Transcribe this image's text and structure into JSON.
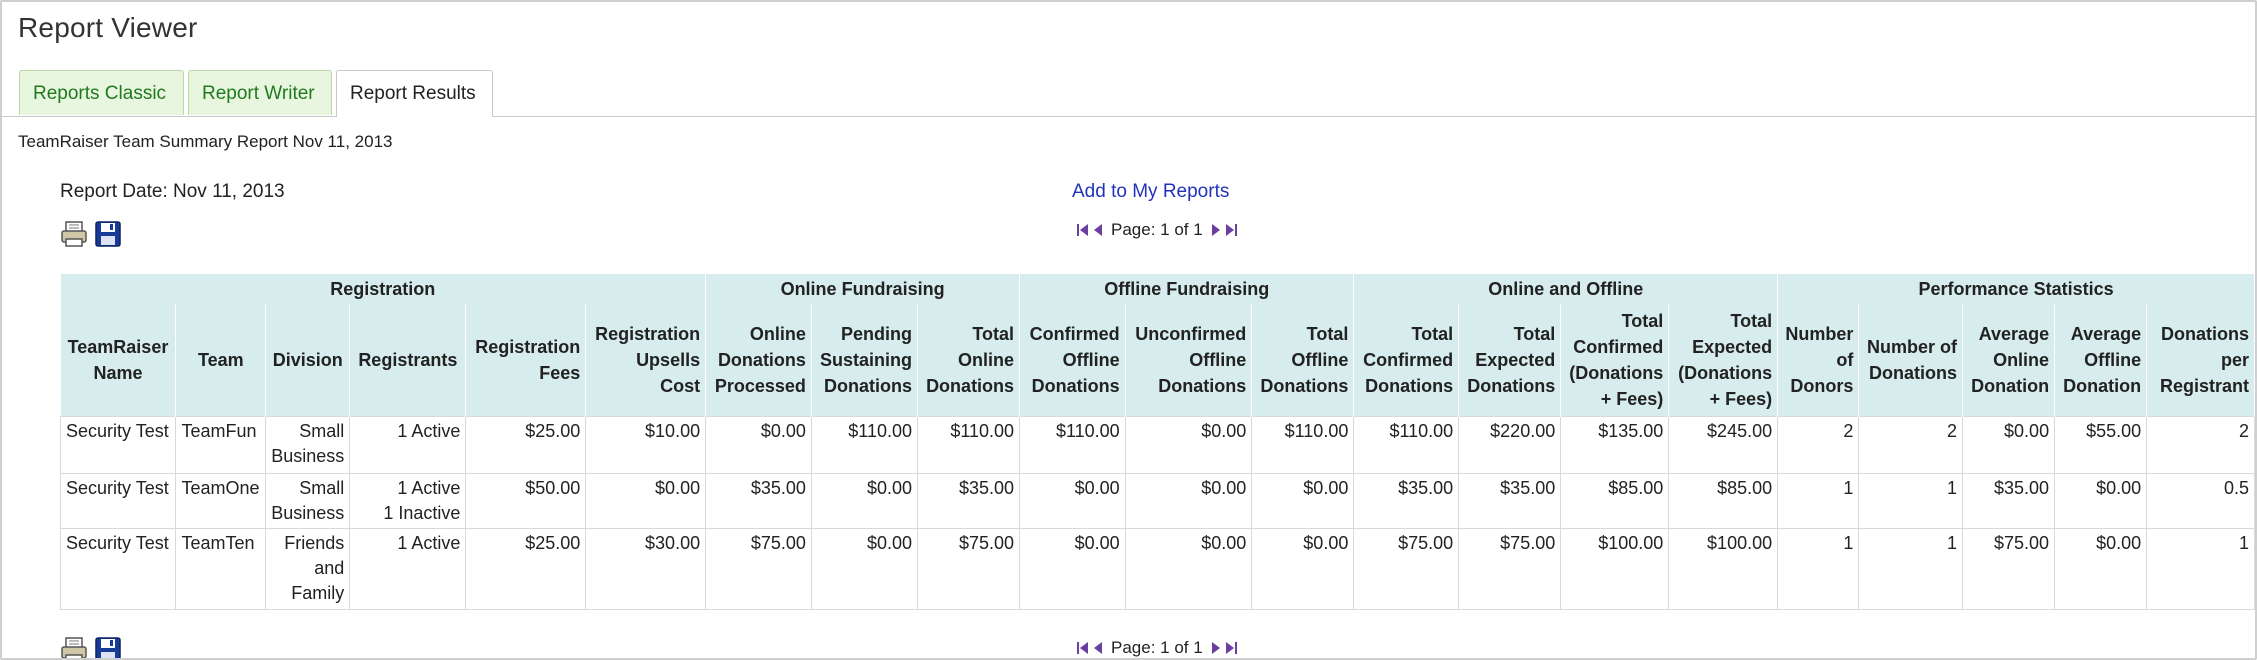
{
  "app": {
    "title": "Report Viewer"
  },
  "tabs": [
    {
      "label": "Reports Classic"
    },
    {
      "label": "Report Writer"
    },
    {
      "label": "Report Results"
    }
  ],
  "report": {
    "heading": "TeamRaiser Team Summary Report Nov 11, 2013",
    "date_label": "Report Date: Nov 11, 2013",
    "add_link": "Add to My Reports",
    "page_label": "Page: 1 of 1",
    "icons": [
      "print-icon",
      "save-icon",
      "first-page-icon",
      "previous-page-icon",
      "next-page-icon",
      "last-page-icon"
    ]
  },
  "table": {
    "groups": [
      {
        "label": "Registration",
        "span": 6
      },
      {
        "label": "Online Fundraising",
        "span": 3
      },
      {
        "label": "Offline Fundraising",
        "span": 3
      },
      {
        "label": "Online and Offline",
        "span": 4
      },
      {
        "label": "Performance Statistics",
        "span": 5
      }
    ],
    "columns": [
      "TeamRaiser Name",
      "Team",
      "Division",
      "Registrants",
      "Registration Fees",
      "Registration Upsells Cost",
      "Online Donations Processed",
      "Pending Sustaining Donations",
      "Total Online Donations",
      "Confirmed Offline Donations",
      "Unconfirmed Offline Donations",
      "Total Offline Donations",
      "Total Confirmed Donations",
      "Total Expected Donations",
      "Total Confirmed (Donations + Fees)",
      "Total Expected (Donations + Fees)",
      "Number of Donors",
      "Number of Donations",
      "Average Online Donation",
      "Average Offline Donation",
      "Donations per Registrant"
    ],
    "rows": [
      [
        "Security Test",
        "TeamFun",
        "Small Business",
        "1 Active",
        "$25.00",
        "$10.00",
        "$0.00",
        "$110.00",
        "$110.00",
        "$110.00",
        "$0.00",
        "$110.00",
        "$110.00",
        "$220.00",
        "$135.00",
        "$245.00",
        "2",
        "2",
        "$0.00",
        "$55.00",
        "2"
      ],
      [
        "Security Test",
        "TeamOne",
        "Small Business",
        "1 Active\n1 Inactive",
        "$50.00",
        "$0.00",
        "$35.00",
        "$0.00",
        "$35.00",
        "$0.00",
        "$0.00",
        "$0.00",
        "$35.00",
        "$35.00",
        "$85.00",
        "$85.00",
        "1",
        "1",
        "$35.00",
        "$0.00",
        "0.5"
      ],
      [
        "Security Test",
        "TeamTen",
        "Friends and Family",
        "1 Active",
        "$25.00",
        "$30.00",
        "$75.00",
        "$0.00",
        "$75.00",
        "$0.00",
        "$0.00",
        "$0.00",
        "$75.00",
        "$75.00",
        "$100.00",
        "$100.00",
        "1",
        "1",
        "$75.00",
        "$0.00",
        "1"
      ]
    ]
  },
  "colors": {
    "tab_inactive_bg": "#e9f6df",
    "tab_inactive_text": "#1f7a1f",
    "header_bg": "#d7ecec",
    "link": "#2233bb",
    "pager_arrows": "#6a3fa0"
  }
}
